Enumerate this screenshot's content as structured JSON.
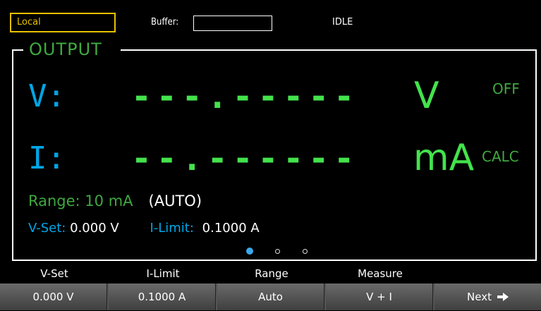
{
  "status_bar": {
    "mode": "Local",
    "buffer_label": "Buffer:",
    "state": "IDLE"
  },
  "panel": {
    "title": "OUTPUT"
  },
  "readings": {
    "voltage": {
      "label": "V:",
      "value": "---.-----",
      "unit": "V",
      "status": "OFF"
    },
    "current": {
      "label": "I:",
      "value": "--.------",
      "unit": "mA",
      "status": "CALC"
    }
  },
  "range": {
    "text": "Range: 10 mA",
    "mode": "(AUTO)"
  },
  "settings": {
    "vset_label": "V-Set:",
    "vset_value": "0.000 V",
    "ilimit_label": "I-Limit:",
    "ilimit_value": "0.1000 A"
  },
  "page_indicator": {
    "count": 3,
    "active": 1
  },
  "softkeys": {
    "labels": [
      "V-Set",
      "I-Limit",
      "Range",
      "Measure",
      ""
    ],
    "values": [
      "0.000 V",
      "0.1000 A",
      "Auto",
      "V + I",
      "Next"
    ]
  },
  "colors": {
    "accent_blue": "#00a6e6",
    "accent_green": "#43e34c",
    "dim_green": "#3fa93f",
    "mode_yellow": "#e9c100"
  }
}
